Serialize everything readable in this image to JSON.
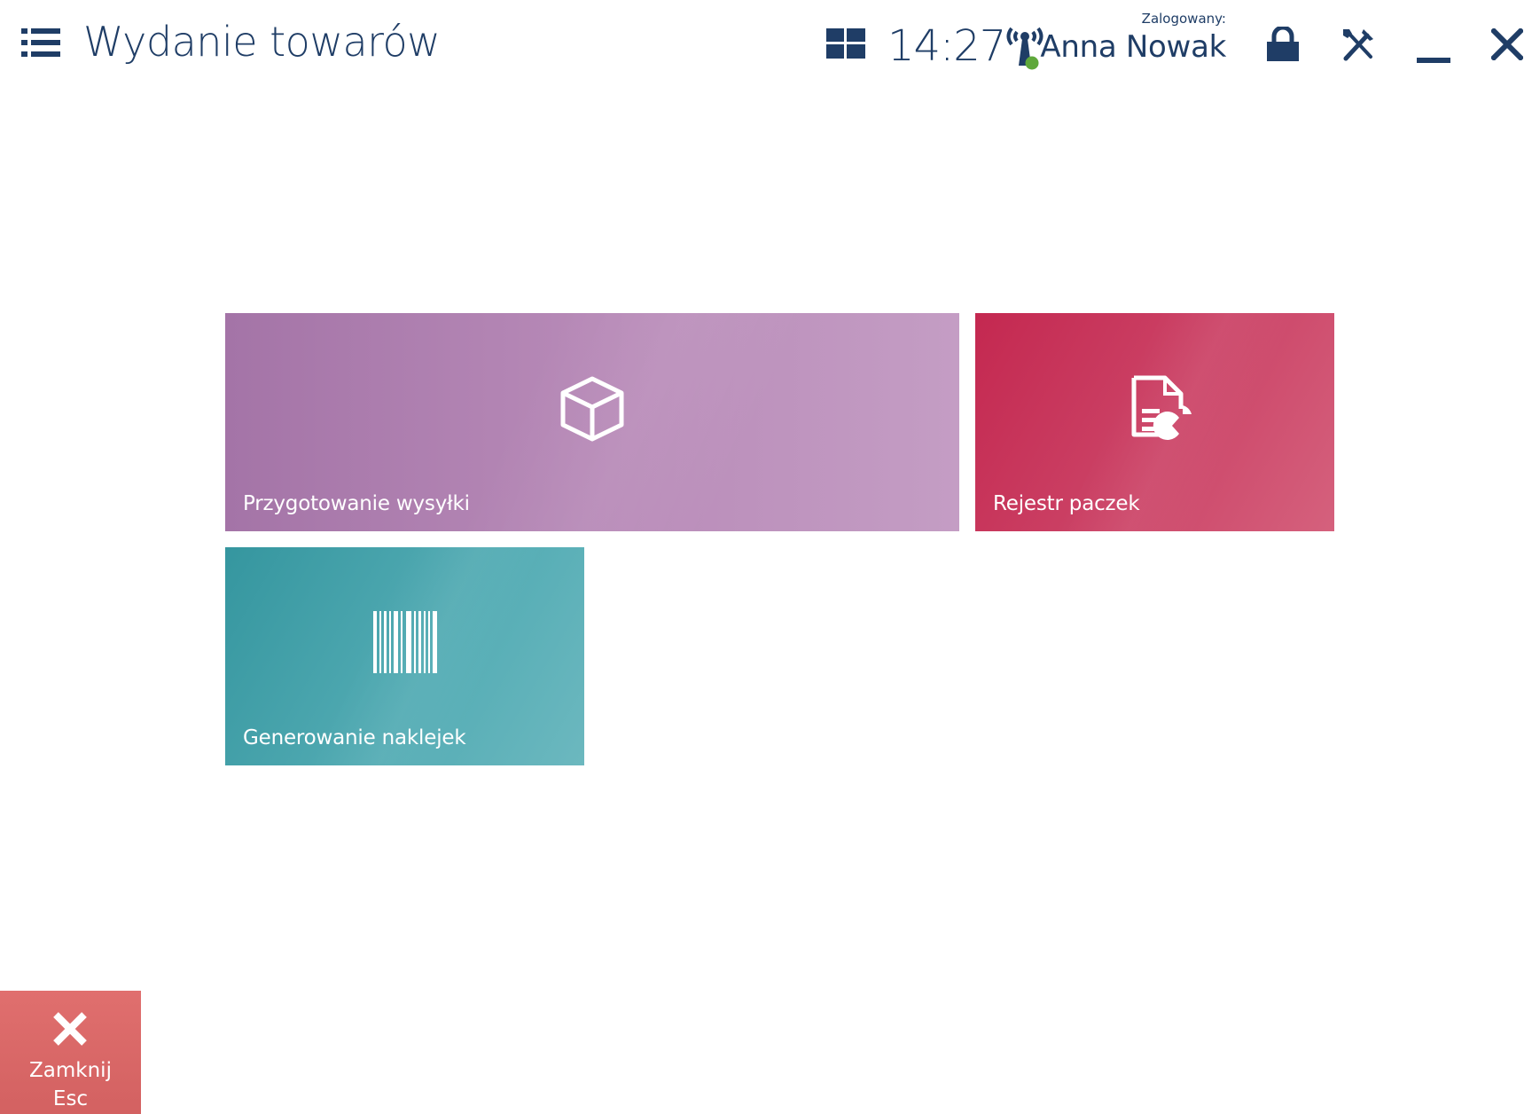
{
  "header": {
    "title": "Wydanie towarów",
    "clock": "14:27",
    "logged_label": "Zalogowany:",
    "user_name": "Anna Nowak",
    "icons": {
      "menu": "list-menu-icon",
      "tiles": "tiles-grid-icon",
      "connection": "antenna-signal-icon",
      "lock": "lock-icon",
      "settings": "tools-icon",
      "minimize": "minimize-icon",
      "close": "close-icon"
    },
    "accent_color": "#1f3d66",
    "connection_status_color": "#5fa83b"
  },
  "tiles": [
    {
      "id": "shipping",
      "label": "Przygotowanie wysyłki",
      "icon": "box-icon",
      "color": "#b383b4"
    },
    {
      "id": "parcels",
      "label": "Rejestr paczek",
      "icon": "report-chart-icon",
      "color": "#c9375c"
    },
    {
      "id": "labels",
      "label": "Generowanie naklejek",
      "icon": "barcode-icon",
      "color": "#4aa4ac"
    }
  ],
  "footer": {
    "close_button": {
      "label": "Zamknij",
      "shortcut": "Esc",
      "icon": "close-icon",
      "color": "#d96666"
    }
  }
}
